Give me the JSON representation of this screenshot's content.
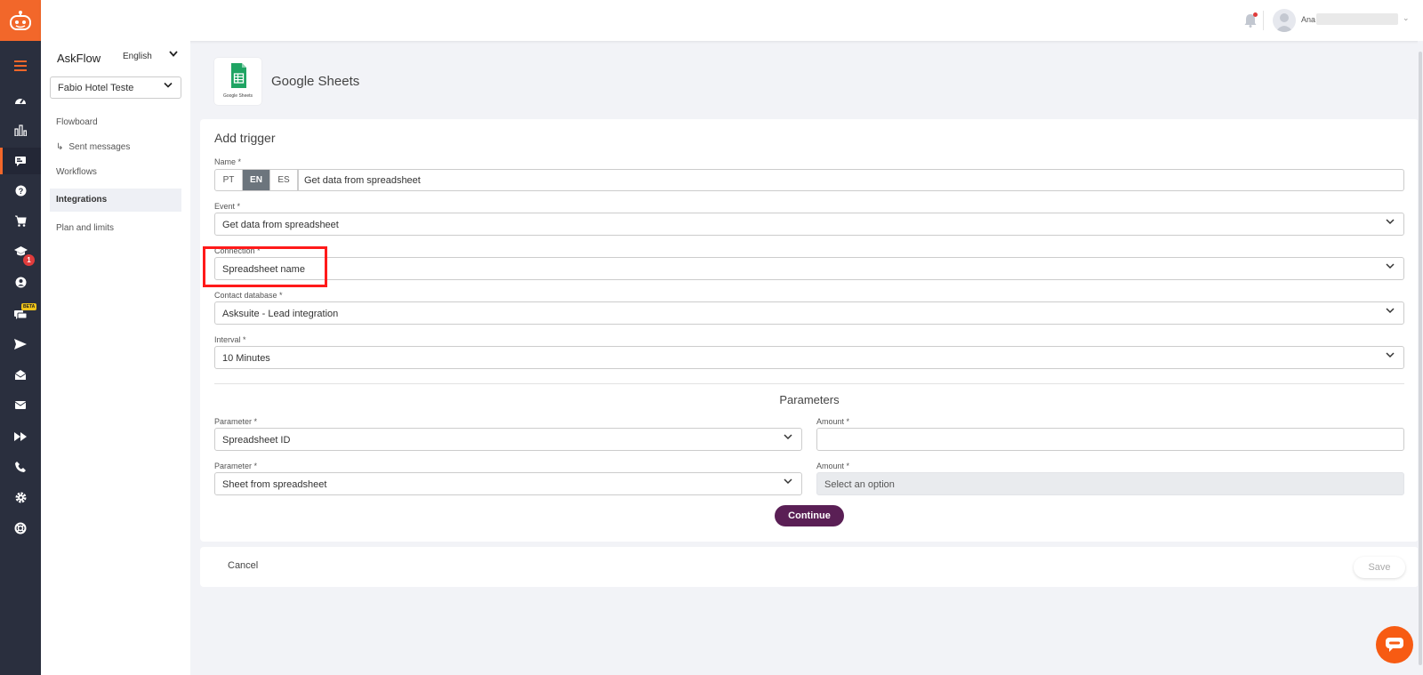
{
  "rail": {
    "beta_label": "BETA",
    "notification_count": "1"
  },
  "topbar": {
    "user_name": "Ana"
  },
  "sidebar": {
    "app_name": "AskFlow",
    "language": "English",
    "hotel": "Fabio Hotel Teste",
    "items": [
      {
        "label": "Flowboard"
      },
      {
        "label": "Sent messages"
      },
      {
        "label": "Workflows"
      },
      {
        "label": "Integrations"
      },
      {
        "label": "Plan and limits"
      }
    ]
  },
  "page": {
    "title": "Google Sheets",
    "logo_caption": "Google Sheets"
  },
  "form": {
    "title": "Add trigger",
    "name": {
      "label": "Name *",
      "langs": [
        "PT",
        "EN",
        "ES"
      ],
      "value": "Get data from spreadsheet"
    },
    "event": {
      "label": "Event *",
      "value": "Get data from spreadsheet"
    },
    "connection": {
      "label": "Connection *",
      "value": "Spreadsheet name"
    },
    "contact_db": {
      "label": "Contact database *",
      "value": "Asksuite - Lead integration"
    },
    "interval": {
      "label": "Interval *",
      "value": "10 Minutes"
    },
    "parameters_title": "Parameters",
    "params": [
      {
        "param_label": "Parameter *",
        "param_value": "Spreadsheet ID",
        "amount_label": "Amount *",
        "amount_value": ""
      },
      {
        "param_label": "Parameter *",
        "param_value": "Sheet from spreadsheet",
        "amount_label": "Amount *",
        "amount_value": "Select an option"
      }
    ],
    "continue_label": "Continue"
  },
  "footer": {
    "cancel_label": "Cancel",
    "save_label": "Save"
  },
  "colors": {
    "brand_orange": "#f2672a",
    "primary_purple": "#5a1f55",
    "rail_bg": "#2a2f3e",
    "highlight_red": "#ff1a1a"
  }
}
